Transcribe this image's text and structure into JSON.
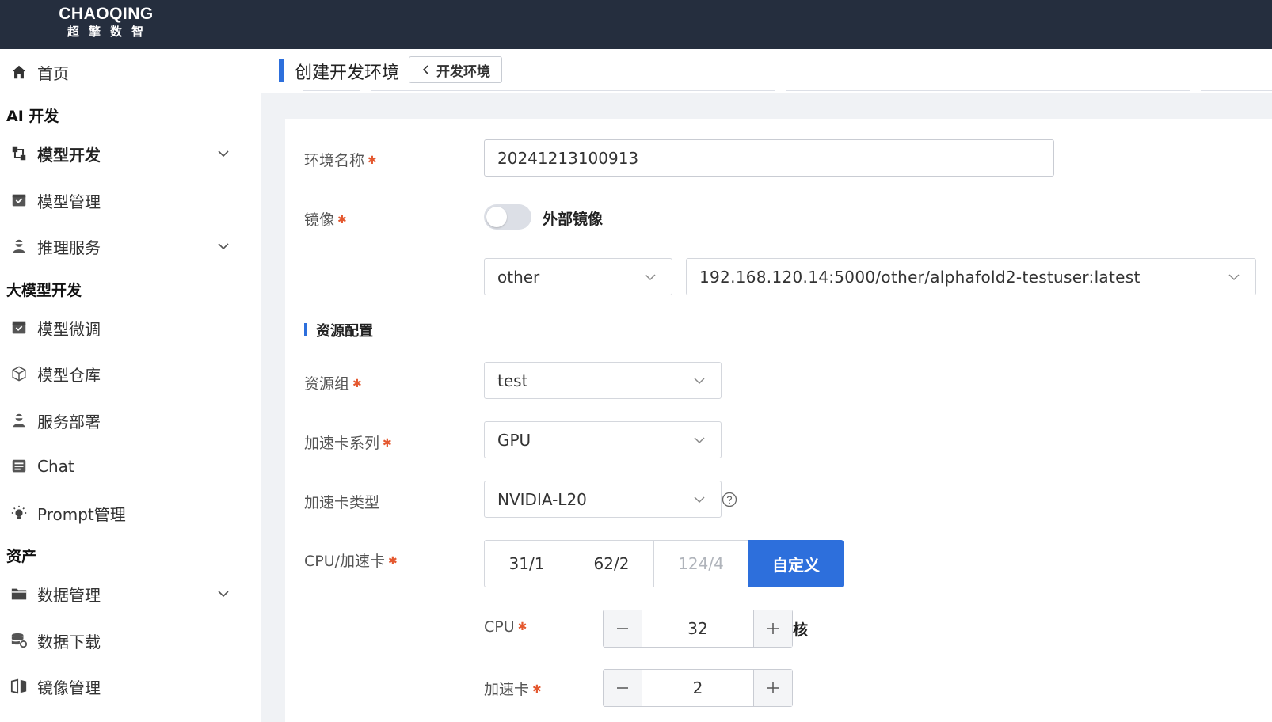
{
  "brand": {
    "name": "CHAOQING",
    "subtitle": "超擎数智"
  },
  "sidebar": {
    "home": {
      "label": "首页",
      "icon": "home-icon"
    },
    "groups": [
      {
        "title": "AI 开发"
      },
      {
        "title": "大模型开发"
      },
      {
        "title": "资产"
      }
    ],
    "items": [
      {
        "label": "模型开发",
        "icon": "model-dev-icon",
        "expandable": true
      },
      {
        "label": "模型管理",
        "icon": "box-icon",
        "expandable": false
      },
      {
        "label": "推理服务",
        "icon": "agent-icon",
        "expandable": true
      },
      {
        "label": "模型微调",
        "icon": "box-icon",
        "expandable": false
      },
      {
        "label": "模型仓库",
        "icon": "cube-icon",
        "expandable": false
      },
      {
        "label": "服务部署",
        "icon": "agent-icon",
        "expandable": false
      },
      {
        "label": "Chat",
        "icon": "chat-icon",
        "expandable": false
      },
      {
        "label": "Prompt管理",
        "icon": "bulb-icon",
        "expandable": false
      },
      {
        "label": "数据管理",
        "icon": "folder-icon",
        "expandable": true
      },
      {
        "label": "数据下载",
        "icon": "database-icon",
        "expandable": false
      },
      {
        "label": "镜像管理",
        "icon": "mirror-icon",
        "expandable": false
      }
    ]
  },
  "header": {
    "title": "创建开发环境",
    "back_label": "开发环境"
  },
  "form": {
    "env_name": {
      "label": "环境名称",
      "value": "20241213100913"
    },
    "image": {
      "label": "镜像",
      "external_toggle_label": "外部镜像",
      "external_enabled": false,
      "category": "other",
      "image_url": "192.168.120.14:5000/other/alphafold2-testuser:latest"
    },
    "resource_section_title": "资源配置",
    "resource_group": {
      "label": "资源组",
      "value": "test"
    },
    "accel_series": {
      "label": "加速卡系列",
      "value": "GPU"
    },
    "accel_type": {
      "label": "加速卡类型",
      "value": "NVIDIA-L20"
    },
    "cpu_accel": {
      "label": "CPU/加速卡",
      "options": [
        "31/1",
        "62/2",
        "124/4",
        "自定义"
      ],
      "disabled": [
        "124/4"
      ],
      "selected": "自定义"
    },
    "cpu": {
      "label": "CPU",
      "value": "32",
      "unit": "核"
    },
    "accel_count": {
      "label": "加速卡",
      "value": "2"
    }
  },
  "colors": {
    "primary": "#2d6fdc",
    "topbar": "#252e3e",
    "required": "#e4572e"
  }
}
